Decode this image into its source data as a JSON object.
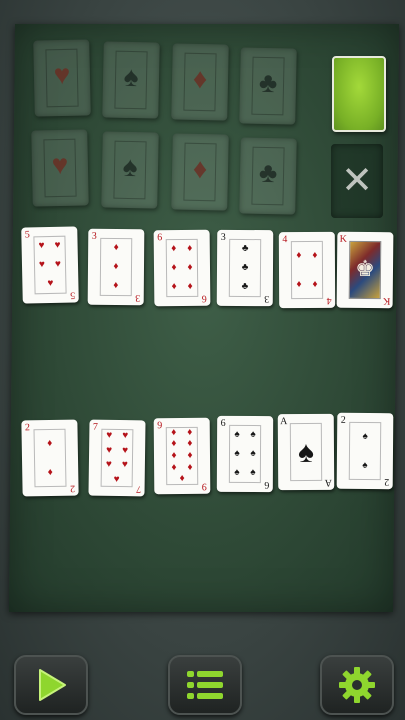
{
  "foundations": [
    {
      "suit": "♥",
      "color": "red"
    },
    {
      "suit": "♠",
      "color": "black"
    },
    {
      "suit": "♦",
      "color": "red"
    },
    {
      "suit": "♣",
      "color": "black"
    },
    {
      "suit": "♥",
      "color": "red"
    },
    {
      "suit": "♠",
      "color": "black"
    },
    {
      "suit": "♦",
      "color": "red"
    },
    {
      "suit": "♣",
      "color": "black"
    }
  ],
  "row1": [
    {
      "rank": "5",
      "suit": "♥",
      "color": "red",
      "pips": 5
    },
    {
      "rank": "3",
      "suit": "♦",
      "color": "red",
      "pips": 3
    },
    {
      "rank": "6",
      "suit": "♦",
      "color": "red",
      "pips": 6
    },
    {
      "rank": "3",
      "suit": "♣",
      "color": "black",
      "pips": 3
    },
    {
      "rank": "4",
      "suit": "♦",
      "color": "red",
      "pips": 4
    },
    {
      "rank": "K",
      "suit": "♥",
      "color": "red",
      "pips": 0
    }
  ],
  "row2": [
    {
      "rank": "2",
      "suit": "♦",
      "color": "red",
      "pips": 2
    },
    {
      "rank": "7",
      "suit": "♥",
      "color": "red",
      "pips": 7
    },
    {
      "rank": "9",
      "suit": "♦",
      "color": "red",
      "pips": 9
    },
    {
      "rank": "6",
      "suit": "♠",
      "color": "black",
      "pips": 6
    },
    {
      "rank": "A",
      "suit": "♠",
      "color": "black",
      "pips": 1
    },
    {
      "rank": "2",
      "suit": "♠",
      "color": "black",
      "pips": 2
    }
  ],
  "stock_empty_symbol": "✕",
  "toolbar": {
    "play_icon": "play-icon",
    "menu_icon": "menu-list-icon",
    "settings_icon": "gear-icon",
    "accent": "#8fd62e"
  }
}
